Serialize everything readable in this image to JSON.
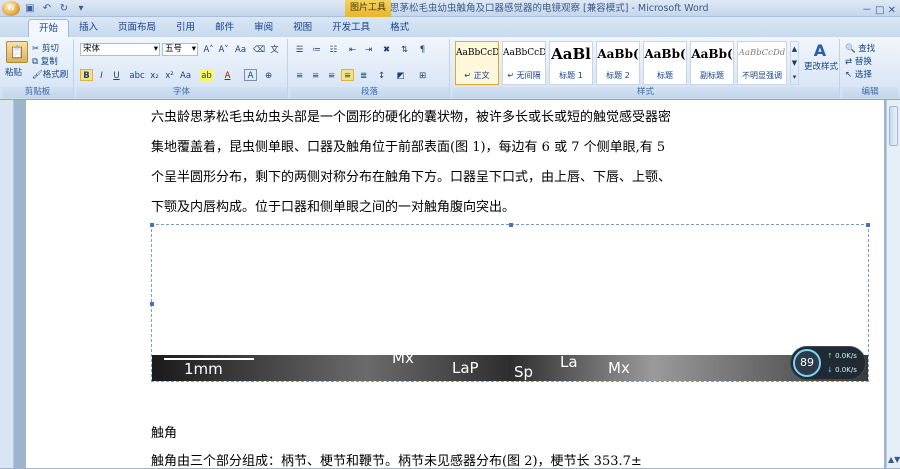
{
  "titlebar": {
    "context_tab": "图片工具",
    "title": "思茅松毛虫幼虫触角及口器感觉器的电镜观察 [兼容模式] - Microsoft Word",
    "controls": "－ □ ✕"
  },
  "tabs": [
    "开始",
    "插入",
    "页面布局",
    "引用",
    "邮件",
    "审阅",
    "视图",
    "开发工具",
    "格式"
  ],
  "clipboard": {
    "paste": "粘贴",
    "cut": "剪切",
    "copy": "复制",
    "format_painter": "格式刷",
    "label": "剪贴板"
  },
  "font": {
    "name": "宋体",
    "size": "五号",
    "label": "字体"
  },
  "paragraph": {
    "label": "段落"
  },
  "styles": {
    "items": [
      {
        "sample": "AaBbCcDc",
        "name": "↵ 正文"
      },
      {
        "sample": "AaBbCcDc",
        "name": "↵ 无间隔"
      },
      {
        "sample": "AaBl",
        "name": "标题 1"
      },
      {
        "sample": "AaBb(",
        "name": "标题 2"
      },
      {
        "sample": "AaBb(",
        "name": "标题"
      },
      {
        "sample": "AaBb(",
        "name": "副标题"
      },
      {
        "sample": "AaBbCcDd",
        "name": "不明显强调"
      }
    ],
    "change": "更改样式",
    "label": "样式"
  },
  "editing": {
    "find": "查找",
    "replace": "替换",
    "select": "选择",
    "label": "编辑"
  },
  "document": {
    "para1_lines": [
      "六虫龄思茅松毛虫幼虫头部是一个圆形的硬化的囊状物，被许多长或长或短的触觉感受器密",
      "集地覆盖着，昆虫侧单眼、口器及触角位于前部表面(图 1)，每边有 6 或 7 个侧单眼,有 5",
      "个呈半圆形分布，剩下的两侧对称分布在触角下方。口器呈下口式，由上唇、下唇、上颚、",
      "下颚及内唇构成。位于口器和侧单眼之间的一对触角腹向突出。"
    ],
    "heading": "触角",
    "para2": "触角由三个部分组成：柄节、梗节和鞭节。柄节未见感器分布(图 2)，梗节长 353.7±"
  },
  "figure": {
    "scale_label": "1mm",
    "labels": [
      "Mx",
      "LaP",
      "Sp",
      "La",
      "Mx"
    ]
  },
  "meter": {
    "percent": "89",
    "up": "0.0K/s",
    "down": "0.0K/s"
  }
}
